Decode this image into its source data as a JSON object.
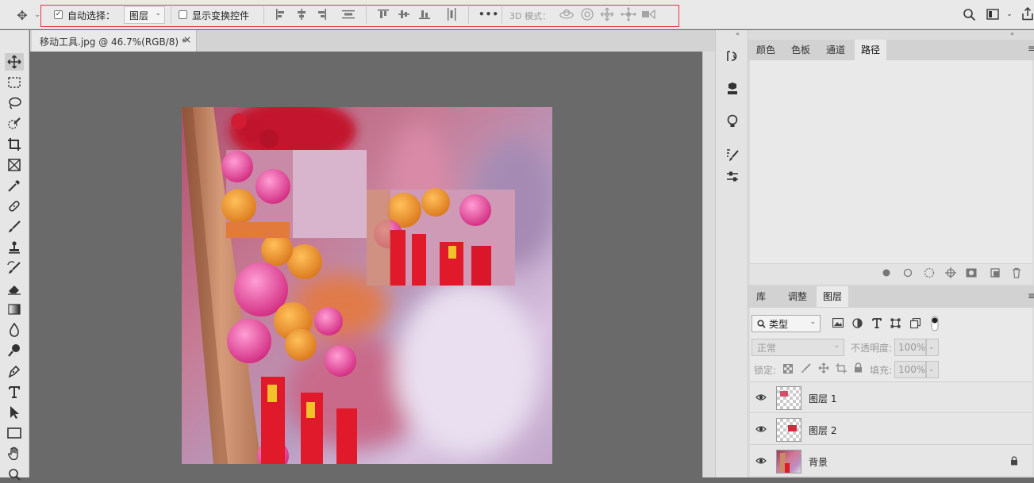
{
  "options_bar": {
    "auto_select_label": "自动选择：",
    "auto_select_checked": true,
    "auto_select_target": "图层",
    "show_transform_label": "显示变换控件",
    "show_transform_checked": false,
    "more_label": "•••",
    "mode_3d_label": "3D 模式："
  },
  "document": {
    "tab_title": "移动工具.jpg @ 46.7%(RGB/8) *",
    "close_glyph": "×"
  },
  "tools": [
    "move-tool",
    "rectangular-marquee-tool",
    "lasso-tool",
    "quick-selection-tool",
    "crop-tool",
    "frame-tool",
    "eyedropper-tool",
    "healing-brush-tool",
    "brush-tool",
    "clone-stamp-tool",
    "history-brush-tool",
    "eraser-tool",
    "gradient-tool",
    "blur-tool",
    "dodge-tool",
    "pen-tool",
    "type-tool",
    "path-selection-tool",
    "rectangle-tool",
    "hand-tool",
    "zoom-tool"
  ],
  "top_panel": {
    "tabs": [
      "颜色",
      "色板",
      "通道",
      "路径"
    ],
    "active_tab": "路径"
  },
  "layers_panel": {
    "tabs": [
      "库",
      "调整",
      "图层"
    ],
    "active_tab": "图层",
    "filter_kind": "类型",
    "blend_mode": "正常",
    "opacity_label": "不透明度:",
    "opacity_value": "100%",
    "lock_label": "锁定:",
    "fill_label": "填充:",
    "fill_value": "100%",
    "layers": [
      {
        "name": "图层 1",
        "visible": true,
        "locked": false
      },
      {
        "name": "图层 2",
        "visible": true,
        "locked": false
      },
      {
        "name": "背景",
        "visible": true,
        "locked": true
      }
    ]
  },
  "colors": {
    "highlight_box": "#e23a3a",
    "panel_bg": "#dcdcdc",
    "canvas_bg": "#6a6a6a"
  }
}
